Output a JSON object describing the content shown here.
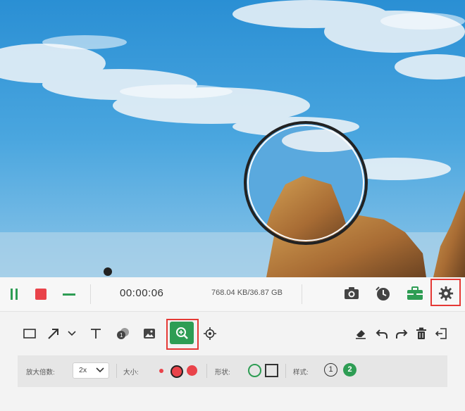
{
  "recorder": {
    "timer": "00:00:06",
    "file_size": "768.04 KB/36.87 GB",
    "buttons": {
      "pause": "pause-icon",
      "stop": "stop-icon",
      "minimize": "minimize-icon",
      "snapshot": "camera-icon",
      "schedule": "clock-icon",
      "toolbox": "toolbox-icon",
      "settings": "gear-icon"
    }
  },
  "tools": [
    "rectangle-icon",
    "arrow-icon",
    "chevron-down-icon",
    "text-icon",
    "bubble-number-icon",
    "image-icon",
    "magnifier-icon",
    "spotlight-icon",
    "eraser-icon",
    "undo-icon",
    "redo-icon",
    "trash-icon",
    "exit-icon"
  ],
  "options": {
    "zoom_label": "放大倍数:",
    "zoom_value": "2x",
    "size_label": "大小:",
    "shape_label": "形状:",
    "style_label": "样式:",
    "style_1": "1",
    "style_2": "2"
  },
  "colors": {
    "accent": "#2e9d54",
    "record_red": "#e9434a",
    "highlight_border": "#e53935"
  }
}
